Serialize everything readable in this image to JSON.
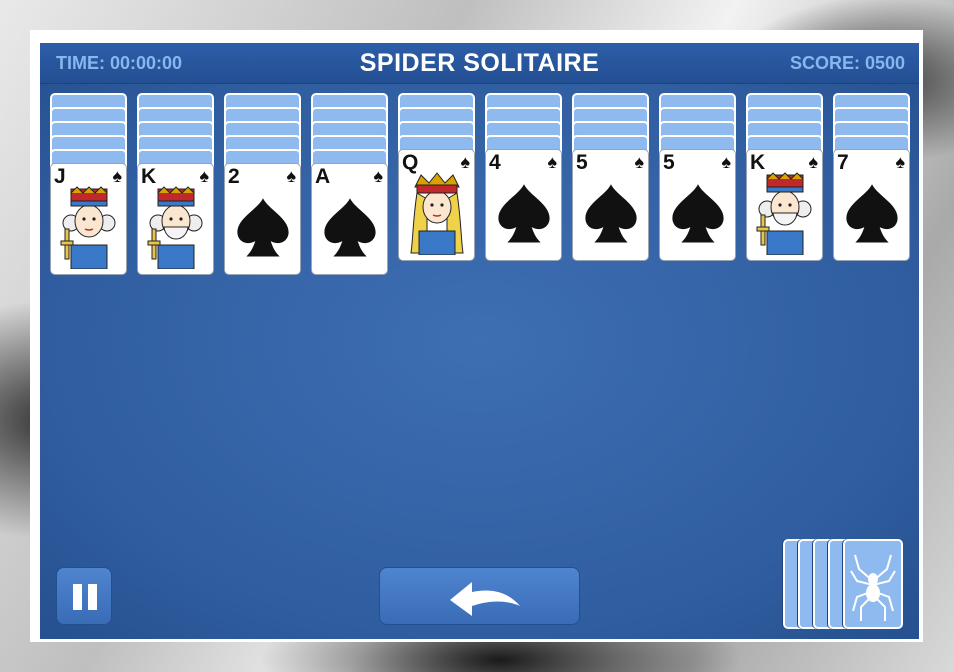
{
  "header": {
    "time": "TIME: 00:00:00",
    "title": "SPIDER SOLITAIRE",
    "score": "SCORE: 0500"
  },
  "tableau": [
    {
      "facedown": 5,
      "rank": "J",
      "suit": "♠",
      "face": true
    },
    {
      "facedown": 5,
      "rank": "K",
      "suit": "♠",
      "face": true
    },
    {
      "facedown": 5,
      "rank": "2",
      "suit": "♠",
      "face": false
    },
    {
      "facedown": 5,
      "rank": "A",
      "suit": "♠",
      "face": false
    },
    {
      "facedown": 4,
      "rank": "Q",
      "suit": "♠",
      "face": true
    },
    {
      "facedown": 4,
      "rank": "4",
      "suit": "♠",
      "face": false
    },
    {
      "facedown": 4,
      "rank": "5",
      "suit": "♠",
      "face": false
    },
    {
      "facedown": 4,
      "rank": "5",
      "suit": "♠",
      "face": false
    },
    {
      "facedown": 4,
      "rank": "K",
      "suit": "♠",
      "face": true
    },
    {
      "facedown": 4,
      "rank": "7",
      "suit": "♠",
      "face": false
    }
  ],
  "stock": {
    "piles": 5,
    "icon": "spider-icon"
  },
  "colors": {
    "board": "#2f5d9f",
    "header_text": "#86b7ee",
    "card_back": "#8fbaf0"
  }
}
